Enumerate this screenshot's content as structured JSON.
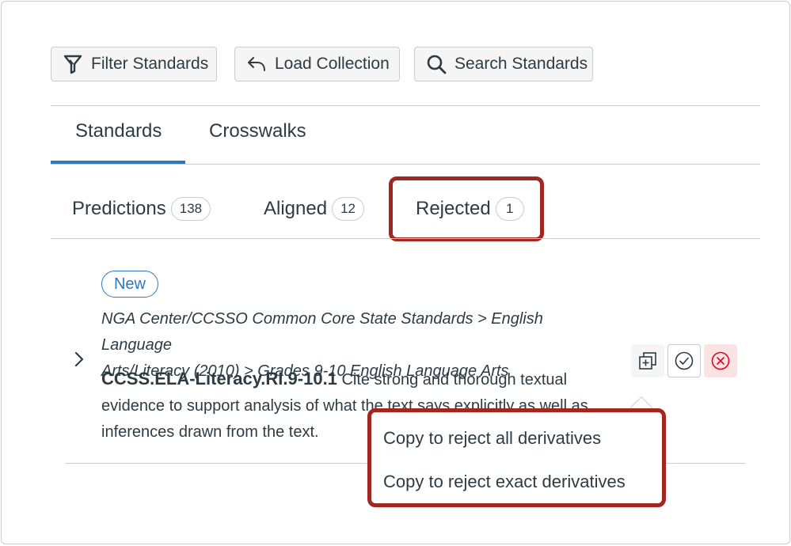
{
  "toolbar": {
    "filter_label": "Filter Standards",
    "load_label": "Load Collection",
    "search_label": "Search Standards"
  },
  "main_tabs": [
    {
      "label": "Standards",
      "selected": true
    },
    {
      "label": "Crosswalks",
      "selected": false
    }
  ],
  "sub_tabs": [
    {
      "label": "Predictions",
      "count": "138"
    },
    {
      "label": "Aligned",
      "count": "12"
    },
    {
      "label": "Rejected",
      "count": "1",
      "highlighted": true
    }
  ],
  "item": {
    "badge": "New",
    "path_line1": "NGA Center/CCSSO Common Core State Standards > English Language",
    "path_line2": "Arts/Literacy (2010) > Grades 9-10 English Language Arts",
    "code": "CCSS.ELA-Literacy.RI.9-10.1",
    "description_line1": " Cite strong and thorough textual",
    "description_line2": "evidence to support analysis of what the text says explicitly as well as",
    "description_line3": "inferences drawn from the text."
  },
  "menu": {
    "item_all": "Copy to reject all derivatives",
    "item_exact": "Copy to reject exact derivatives"
  },
  "colors": {
    "accent": "#2b7abc",
    "highlight": "#a02820",
    "reject": "#e0061f"
  },
  "icons": {
    "filter": "filter-icon",
    "load": "undo-arrow-icon",
    "search": "search-icon",
    "expand": "chevron-right-icon",
    "copy": "copy-icon",
    "approve": "check-circle-icon",
    "reject": "x-circle-icon"
  }
}
